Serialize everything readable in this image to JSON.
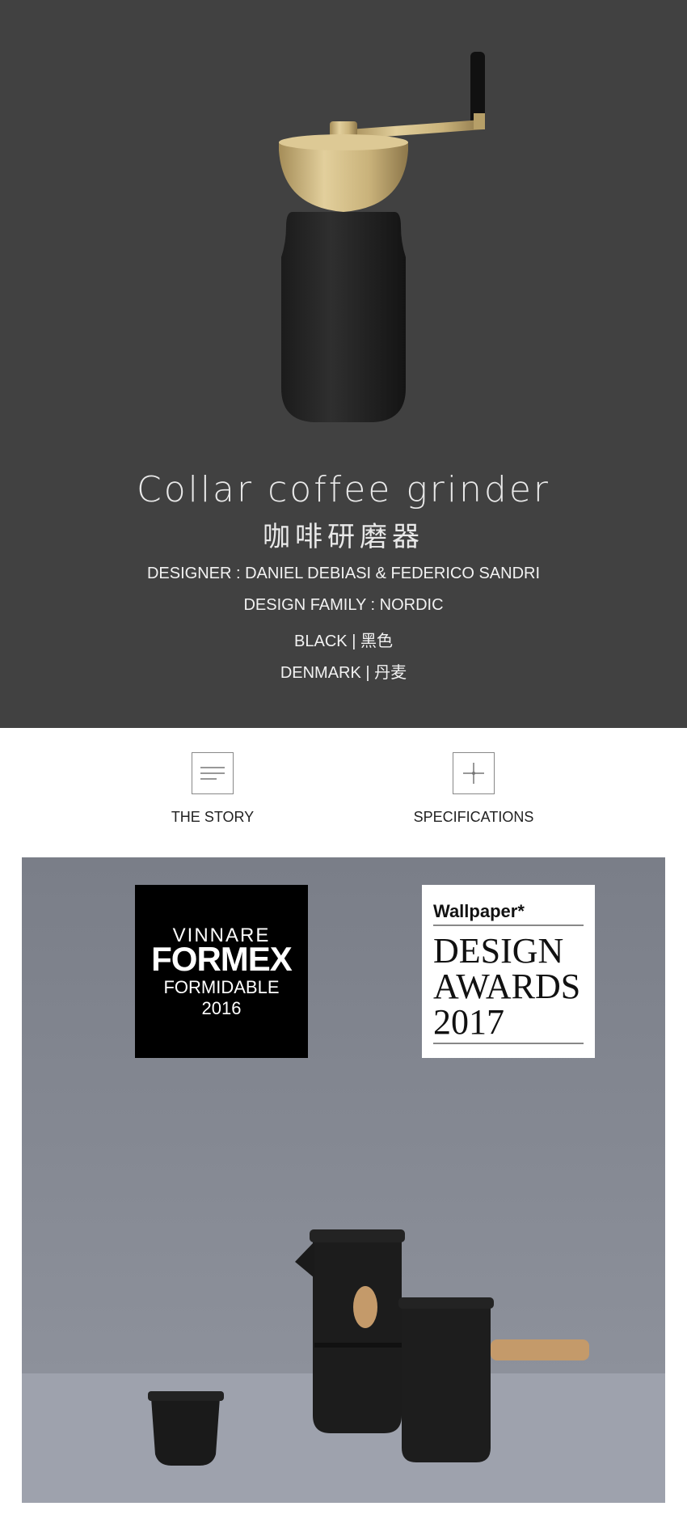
{
  "hero": {
    "title_en": "Collar coffee grinder",
    "title_zh": "咖啡研磨器",
    "designer": "DESIGNER : DANIEL DEBIASI & FEDERICO SANDRI",
    "design_family": "DESIGN FAMILY : NORDIC",
    "color": "BLACK | 黑色",
    "origin": "DENMARK | 丹麦",
    "colors": {
      "background": "#414141",
      "text": "#f2f2f2",
      "brass": "#c9b27a"
    }
  },
  "tabs": [
    {
      "label": "THE STORY",
      "icon": "text-lines-icon"
    },
    {
      "label": "SPECIFICATIONS",
      "icon": "crosshair-icon"
    }
  ],
  "awards": {
    "formex": {
      "line1": "VINNARE",
      "line2": "FORMEX",
      "line3": "FORMIDABLE",
      "line4": "2016"
    },
    "wallpaper": {
      "brand": "Wallpaper*",
      "line1": "DESIGN",
      "line2": "AWARDS",
      "line3": "2017"
    }
  }
}
